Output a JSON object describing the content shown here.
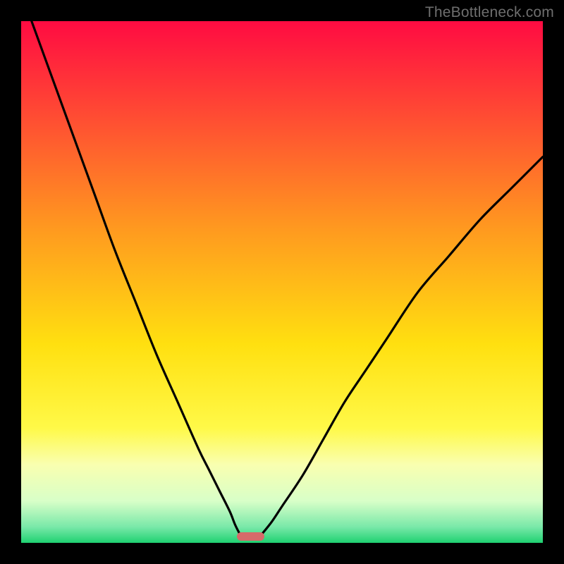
{
  "watermark": {
    "text": "TheBottleneck.com"
  },
  "chart_data": {
    "type": "line",
    "title": "",
    "xlabel": "",
    "ylabel": "",
    "xlim": [
      0,
      100
    ],
    "ylim": [
      0,
      100
    ],
    "grid": false,
    "legend": false,
    "background_gradient_stops": [
      {
        "pct": 0,
        "color": "#ff0b42"
      },
      {
        "pct": 18,
        "color": "#ff4b33"
      },
      {
        "pct": 40,
        "color": "#ff9a1f"
      },
      {
        "pct": 62,
        "color": "#ffe010"
      },
      {
        "pct": 78,
        "color": "#fff948"
      },
      {
        "pct": 85,
        "color": "#f9ffb0"
      },
      {
        "pct": 92,
        "color": "#d8ffc8"
      },
      {
        "pct": 97,
        "color": "#78e8a8"
      },
      {
        "pct": 100,
        "color": "#1fd171"
      }
    ],
    "series": [
      {
        "name": "bottleneck-curve-left",
        "x": [
          2,
          6,
          10,
          14,
          18,
          22,
          26,
          30,
          34,
          36,
          38,
          40,
          41,
          42
        ],
        "y": [
          100,
          89,
          78,
          67,
          56,
          46,
          36,
          27,
          18,
          14,
          10,
          6,
          3.5,
          1.5
        ]
      },
      {
        "name": "bottleneck-curve-right",
        "x": [
          46,
          48,
          50,
          54,
          58,
          62,
          66,
          70,
          76,
          82,
          88,
          94,
          100
        ],
        "y": [
          1.5,
          4,
          7,
          13,
          20,
          27,
          33,
          39,
          48,
          55,
          62,
          68,
          74
        ]
      }
    ],
    "marker": {
      "x_start": 41.3,
      "x_end": 46.6,
      "y": 1.2,
      "color": "#d66a6a"
    },
    "minimum_point": {
      "x": 44,
      "y": 1
    }
  }
}
